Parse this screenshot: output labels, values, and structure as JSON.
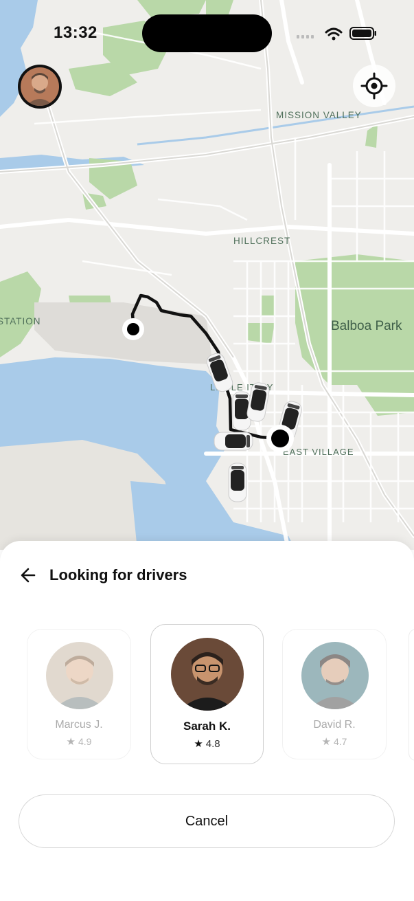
{
  "status_bar": {
    "time": "13:32"
  },
  "map": {
    "labels": {
      "mission_valley": "MISSION VALLEY",
      "hillcrest": "HILLCREST",
      "station": "STATION",
      "balboa_park": "Balboa Park",
      "little_italy": "LITTLE ITALY",
      "east_village": "EAST VILLAGE"
    }
  },
  "sheet": {
    "title": "Looking for drivers",
    "back_icon": "arrow-left-icon",
    "drivers": [
      {
        "name": "Marcus J.",
        "rating": "4.9",
        "selected": false
      },
      {
        "name": "Sarah K.",
        "rating": "4.8",
        "selected": true
      },
      {
        "name": "David R.",
        "rating": "4.7",
        "selected": false
      }
    ],
    "cancel_label": "Cancel"
  },
  "colors": {
    "water": "#a9cbe9",
    "park": "#b9d8a8",
    "land": "#efeeeb",
    "road": "#ffffff",
    "route": "#111111"
  }
}
